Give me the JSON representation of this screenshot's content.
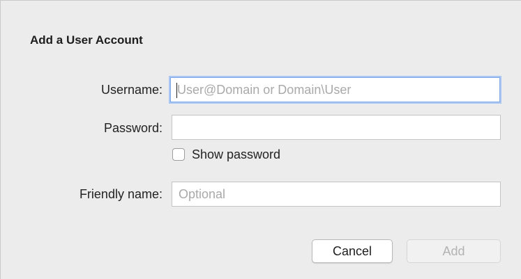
{
  "dialog": {
    "title": "Add a User Account"
  },
  "username": {
    "label": "Username:",
    "placeholder": "User@Domain or Domain\\User",
    "value": ""
  },
  "password": {
    "label": "Password:",
    "value": ""
  },
  "show_password": {
    "label": "Show password",
    "checked": false
  },
  "friendly_name": {
    "label": "Friendly name:",
    "placeholder": "Optional",
    "value": ""
  },
  "buttons": {
    "cancel_label": "Cancel",
    "add_label": "Add",
    "add_enabled": false
  },
  "colors": {
    "focus_ring": "#a9c7f2",
    "dialog_background": "#ececec",
    "disabled_text": "#b3b3b3"
  }
}
